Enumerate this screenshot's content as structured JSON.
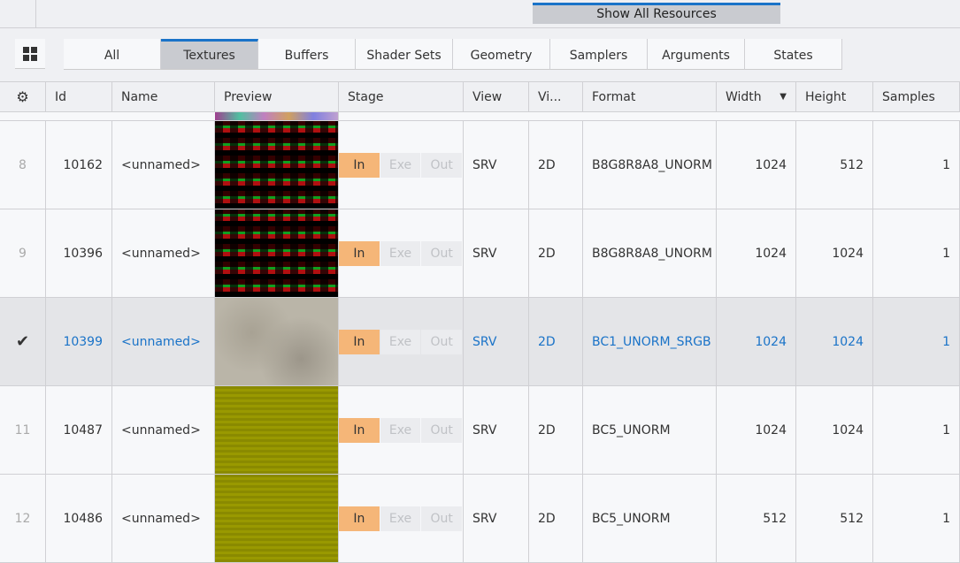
{
  "toolbar": {
    "show_all": "Show All Resources"
  },
  "tabs": [
    "All",
    "Textures",
    "Buffers",
    "Shader Sets",
    "Geometry",
    "Samplers",
    "Arguments",
    "States"
  ],
  "active_tab": "Textures",
  "columns": [
    "Id",
    "Name",
    "Preview",
    "Stage",
    "View",
    "Vi...",
    "Format",
    "Width",
    "Height",
    "Samples"
  ],
  "stages": [
    "In",
    "Exe",
    "Out"
  ],
  "rows": [
    {
      "idx": "8",
      "id": "10162",
      "name": "<unnamed>",
      "view": "SRV",
      "dim": "2D",
      "format": "B8G8R8A8_UNORM",
      "width": "1024",
      "height": "512",
      "samples": "1",
      "preview": "redgreen"
    },
    {
      "idx": "9",
      "id": "10396",
      "name": "<unnamed>",
      "view": "SRV",
      "dim": "2D",
      "format": "B8G8R8A8_UNORM",
      "width": "1024",
      "height": "1024",
      "samples": "1",
      "preview": "redgreen"
    },
    {
      "idx": "✔",
      "id": "10399",
      "name": "<unnamed>",
      "view": "SRV",
      "dim": "2D",
      "format": "BC1_UNORM_SRGB",
      "width": "1024",
      "height": "1024",
      "samples": "1",
      "preview": "stone",
      "selected": true
    },
    {
      "idx": "11",
      "id": "10487",
      "name": "<unnamed>",
      "view": "SRV",
      "dim": "2D",
      "format": "BC5_UNORM",
      "width": "1024",
      "height": "1024",
      "samples": "1",
      "preview": "olive"
    },
    {
      "idx": "12",
      "id": "10486",
      "name": "<unnamed>",
      "view": "SRV",
      "dim": "2D",
      "format": "BC5_UNORM",
      "width": "512",
      "height": "512",
      "samples": "1",
      "preview": "olive"
    }
  ]
}
